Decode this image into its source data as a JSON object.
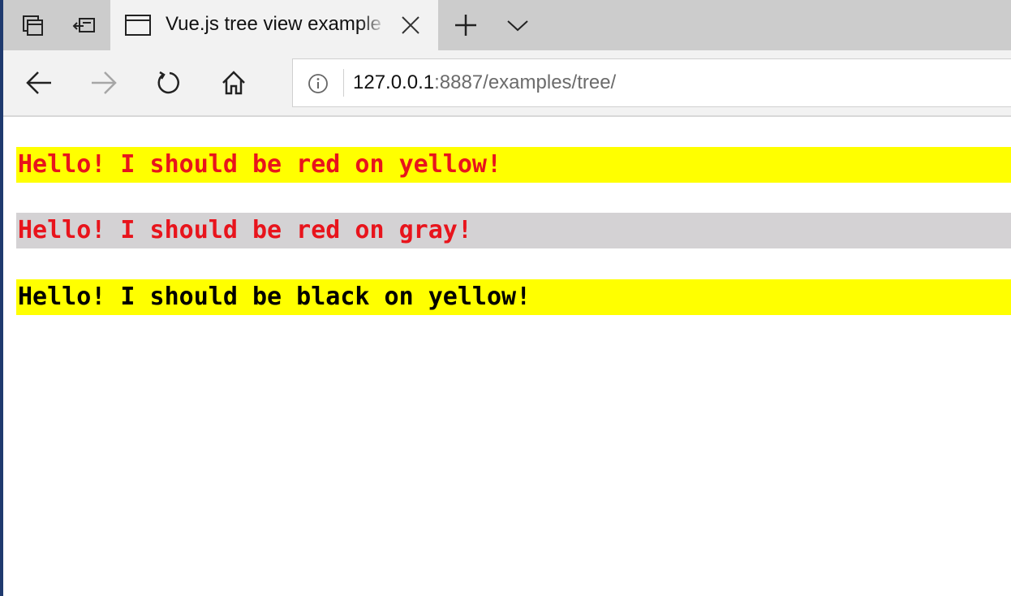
{
  "tab": {
    "title": "Vue.js tree view example"
  },
  "address": {
    "host": "127.0.0.1",
    "rest": ":8887/examples/tree/"
  },
  "icons": {
    "tab_actions": "tab-actions-icon",
    "set_aside": "set-aside-tabs-icon",
    "favicon": "page-icon",
    "close": "close-icon",
    "new_tab": "plus-icon",
    "tab_list": "chevron-down-icon",
    "back": "back-arrow-icon",
    "forward": "forward-arrow-icon",
    "refresh": "refresh-icon",
    "home": "home-icon",
    "info": "info-icon"
  },
  "page": {
    "lines": [
      {
        "text": "Hello! I should be red on yellow!",
        "color": "#e8141c",
        "background": "#ffff00"
      },
      {
        "text": "Hello! I should be red on gray!",
        "color": "#e8141c",
        "background": "#d4d2d4"
      },
      {
        "text": "Hello! I should be black on yellow!",
        "color": "#000000",
        "background": "#ffff00"
      }
    ]
  },
  "colors": {
    "tabbar": "#cccccc",
    "active_tab": "#f2f2f2",
    "window_border": "#1f3a6e"
  }
}
